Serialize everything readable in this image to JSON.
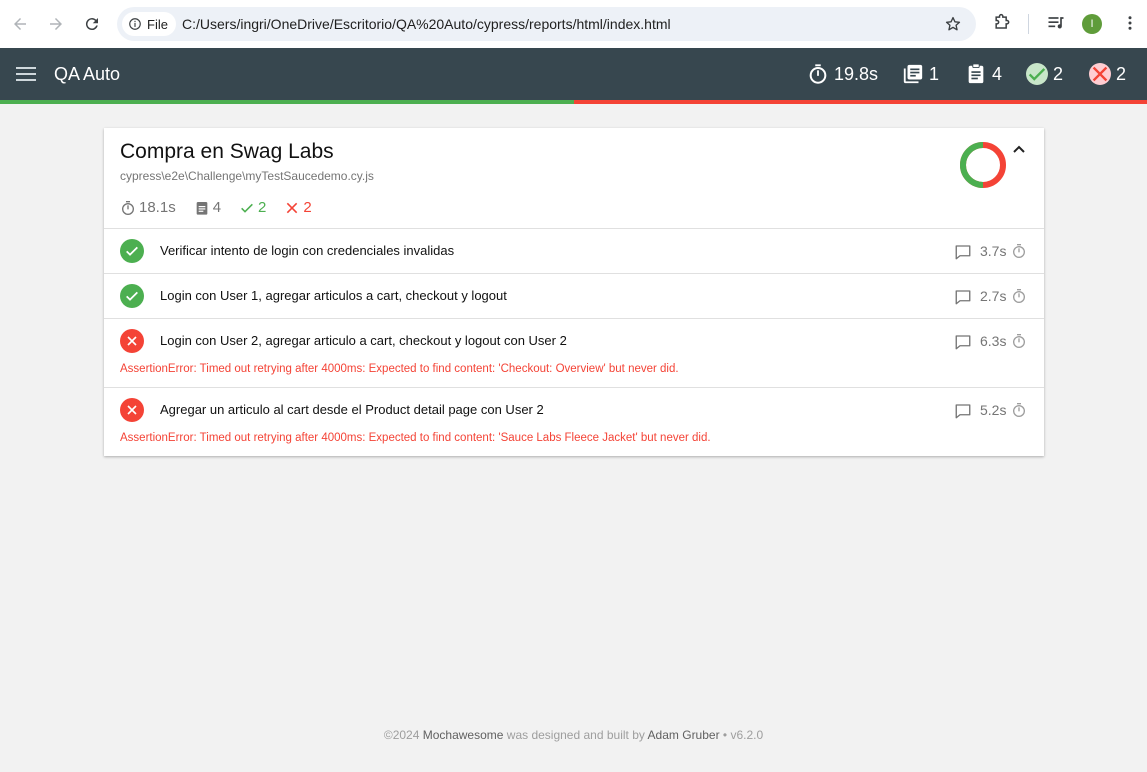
{
  "browser": {
    "file_label": "File",
    "url": "C:/Users/ingri/OneDrive/Escritorio/QA%20Auto/cypress/reports/html/index.html",
    "profile_initial": "I"
  },
  "appbar": {
    "title": "QA Auto",
    "duration": "19.8s",
    "suites": "1",
    "tests": "4",
    "passed": "2",
    "failed": "2",
    "pass_fraction": 0.5,
    "colors": {
      "bar": "#37474f",
      "pass": "#4caf50",
      "fail": "#f44336"
    }
  },
  "suite": {
    "title": "Compra en Swag Labs",
    "file": "cypress\\e2e\\Challenge\\myTestSaucedemo.cy.js",
    "duration": "18.1s",
    "tests": "4",
    "passed": "2",
    "failed": "2",
    "tests_list": [
      {
        "status": "passed",
        "name": "Verificar intento de login con credenciales invalidas",
        "duration": "3.7s"
      },
      {
        "status": "passed",
        "name": "Login con User 1, agregar articulos a cart, checkout y logout",
        "duration": "2.7s"
      },
      {
        "status": "failed",
        "name": "Login con User 2, agregar articulo a cart, checkout y logout con User 2",
        "duration": "6.3s",
        "error": "AssertionError: Timed out retrying after 4000ms: Expected to find content: 'Checkout: Overview' but never did."
      },
      {
        "status": "failed",
        "name": "Agregar un articulo al cart desde el Product detail page con User 2",
        "duration": "5.2s",
        "error": "AssertionError: Timed out retrying after 4000ms: Expected to find content: 'Sauce Labs Fleece Jacket' but never did."
      }
    ]
  },
  "footer": {
    "prefix": "©2024 ",
    "brand": "Mochawesome",
    "middle": " was designed and built by ",
    "author": "Adam Gruber",
    "version": " • v6.2.0"
  }
}
